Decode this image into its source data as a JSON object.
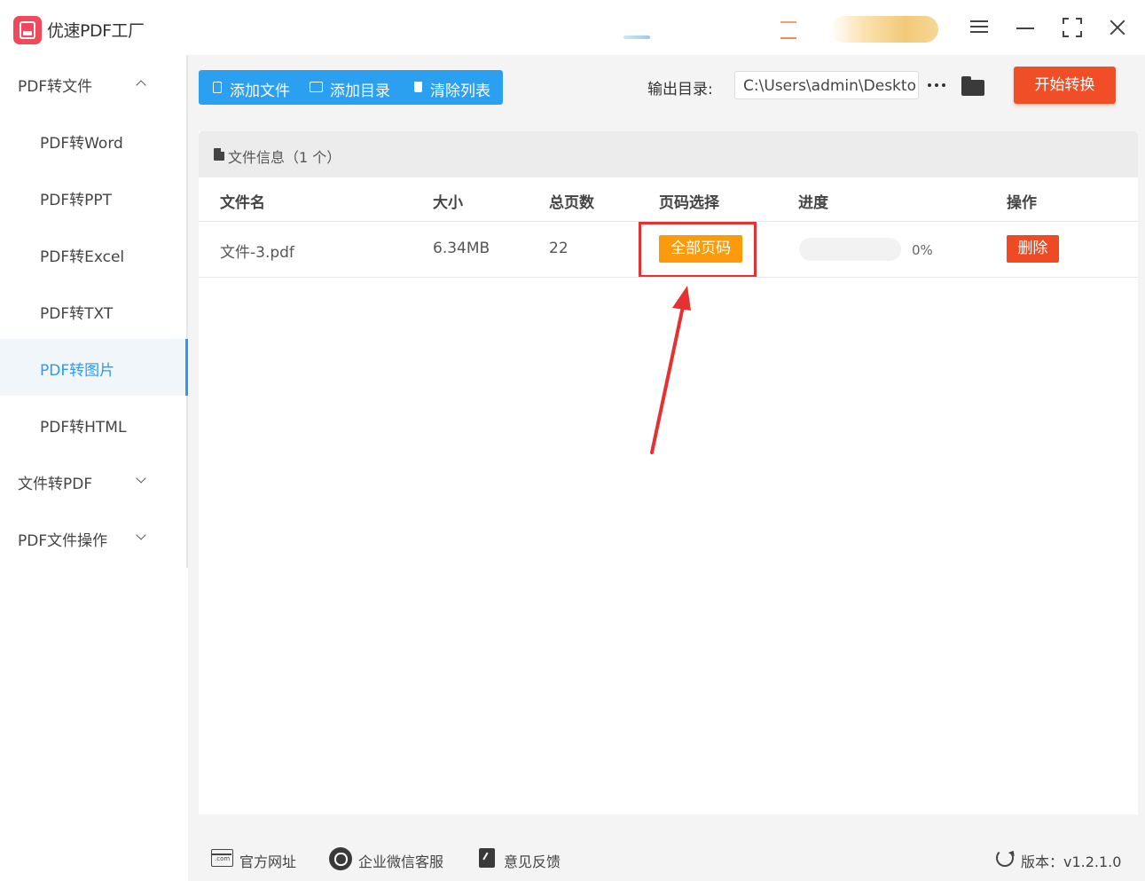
{
  "app": {
    "title": "优速PDF工厂"
  },
  "sidebar": {
    "items": [
      {
        "label": "PDF转文件",
        "type": "group",
        "expanded": true
      },
      {
        "label": "PDF转Word",
        "type": "sub"
      },
      {
        "label": "PDF转PPT",
        "type": "sub"
      },
      {
        "label": "PDF转Excel",
        "type": "sub"
      },
      {
        "label": "PDF转TXT",
        "type": "sub"
      },
      {
        "label": "PDF转图片",
        "type": "sub",
        "active": true
      },
      {
        "label": "PDF转HTML",
        "type": "sub"
      },
      {
        "label": "文件转PDF",
        "type": "group",
        "expanded": false
      },
      {
        "label": "PDF文件操作",
        "type": "group",
        "expanded": false
      }
    ]
  },
  "toolbar": {
    "add_file": "添加文件",
    "add_folder": "添加目录",
    "clear_list": "清除列表",
    "output_label": "输出目录:",
    "output_path": "C:\\Users\\admin\\Deskto",
    "start": "开始转换"
  },
  "panel": {
    "title": "文件信息（1 个）",
    "columns": {
      "name": "文件名",
      "size": "大小",
      "pages": "总页数",
      "page_select": "页码选择",
      "progress": "进度",
      "action": "操作"
    },
    "rows": [
      {
        "name": "文件-3.pdf",
        "size": "6.34MB",
        "pages": "22",
        "page_select": "全部页码",
        "progress_percent": 0,
        "progress_text": "0%",
        "action": "删除"
      }
    ]
  },
  "footer": {
    "website": "官方网址",
    "wechat": "企业微信客服",
    "feedback": "意见反馈",
    "version": "版本：v1.2.1.0"
  },
  "colors": {
    "primary_blue": "#2ba0f1",
    "start_red": "#f04e26",
    "page_orange": "#fb9b0c",
    "highlight_red": "#e53131"
  }
}
